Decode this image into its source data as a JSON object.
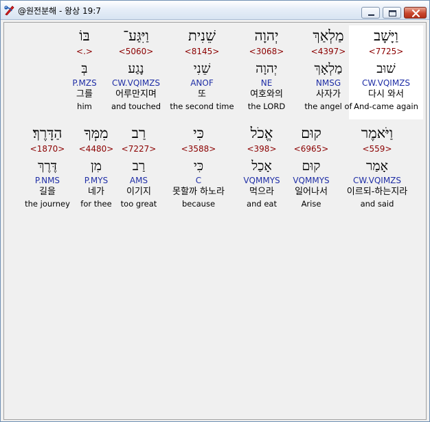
{
  "window": {
    "title": "@원전분해 - 왕상 19:7",
    "minimize_icon": "minimize-icon",
    "maximize_icon": "maximize-icon",
    "close_icon": "close-icon",
    "app_icon": "app-logo-icon"
  },
  "colors": {
    "strong": "#8b0000",
    "morph": "#1f2ea6",
    "selected_bg": "#ffffff"
  },
  "rows": [
    {
      "words": [
        {
          "heb": "וַיָּשָׁב",
          "strong": "<7725>",
          "lemma": "שׁוּב",
          "morph": "CW.VQIMZS",
          "kor": "다시 와서",
          "eng": "And-came again",
          "selected": true
        },
        {
          "heb": "מַלְאַךְ",
          "strong": "<4397>",
          "lemma": "מַלְאָךְ",
          "morph": "NMSG",
          "kor": "사자가",
          "eng": "the angel of"
        },
        {
          "heb": "יְהוָה",
          "strong": "<3068>",
          "lemma": "יְהוָה",
          "morph": "NE",
          "kor": "여호와의",
          "eng": "the LORD"
        },
        {
          "heb": "שֵׁנִית",
          "strong": "<8145>",
          "lemma": "שֵׁנִי",
          "morph": "ANOF",
          "kor": "또",
          "eng": "the second time"
        },
        {
          "heb": "וַיִּגַּע־",
          "strong": "<5060>",
          "lemma": "נָגַע",
          "morph": "CW.VQIMZS",
          "kor": "어루만지며",
          "eng": "and touched"
        },
        {
          "heb": "בּוֹ",
          "strong": "<.>",
          "lemma": "בְּ",
          "morph": "P.MZS",
          "kor": "그를",
          "eng": "him"
        }
      ]
    },
    {
      "words": [
        {
          "heb": "וַיֹּאמֶר",
          "strong": "<559>",
          "lemma": "אָמַר",
          "morph": "CW.VQIMZS",
          "kor": "이르되-하는지라",
          "eng": "and said"
        },
        {
          "heb": "קוּם",
          "strong": "<6965>",
          "lemma": "קוּם",
          "morph": "VQMMYS",
          "kor": "일어나서",
          "eng": "Arise"
        },
        {
          "heb": "אֱכֹל",
          "strong": "<398>",
          "lemma": "אָכַל",
          "morph": "VQMMYS",
          "kor": "먹으라",
          "eng": "and eat"
        },
        {
          "heb": "כִּי",
          "strong": "<3588>",
          "lemma": "כִּי",
          "morph": "C",
          "kor": "못할까 하노라",
          "eng": "because"
        },
        {
          "heb": "רַב",
          "strong": "<7227>",
          "lemma": "רַב",
          "morph": "AMS",
          "kor": "이기지",
          "eng": "too great"
        },
        {
          "heb": "מִמְּךָ",
          "strong": "<4480>",
          "lemma": "מִן",
          "morph": "P.MYS",
          "kor": "네가",
          "eng": "for thee"
        },
        {
          "heb": "הַדָּרֶךְ׃",
          "strong": "<1870>",
          "lemma": "דֶּרֶךְ",
          "morph": "P.NMS",
          "kor": "길을",
          "eng": "the journey"
        }
      ]
    }
  ]
}
